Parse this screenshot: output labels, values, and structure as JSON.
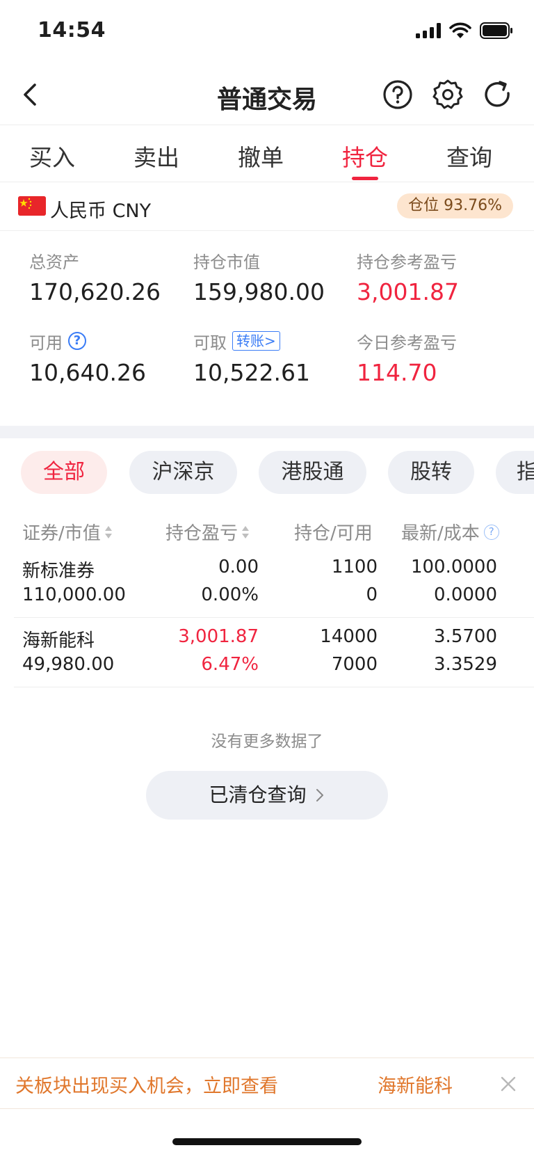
{
  "status": {
    "time": "14:54"
  },
  "nav": {
    "title": "普通交易"
  },
  "tabs": [
    "买入",
    "卖出",
    "撤单",
    "持仓",
    "查询"
  ],
  "active_tab": "持仓",
  "currency": {
    "label": "人民币 CNY",
    "position": "仓位 93.76%"
  },
  "summary": {
    "total_assets_label": "总资产",
    "total_assets": "170,620.26",
    "market_value_label": "持仓市值",
    "market_value": "159,980.00",
    "ref_pnl_label": "持仓参考盈亏",
    "ref_pnl": "3,001.87",
    "available_label": "可用",
    "available": "10,640.26",
    "withdrawable_label": "可取",
    "transfer_label": "转账>",
    "withdrawable": "10,522.61",
    "today_pnl_label": "今日参考盈亏",
    "today_pnl": "114.70"
  },
  "filters": [
    "全部",
    "沪深京",
    "港股通",
    "股转",
    "指"
  ],
  "table": {
    "headers": [
      "证券/市值",
      "持仓盈亏",
      "持仓/可用",
      "最新/成本"
    ],
    "rows": [
      {
        "name": "新标准券",
        "value": "110,000.00",
        "pnl": "0.00",
        "pnl_pct": "0.00%",
        "hold": "1100",
        "avail": "0",
        "latest": "100.0000",
        "cost": "0.0000"
      },
      {
        "name": "海新能科",
        "value": "49,980.00",
        "pnl": "3,001.87",
        "pnl_pct": "6.47%",
        "hold": "14000",
        "avail": "7000",
        "latest": "3.5700",
        "cost": "3.3529"
      }
    ]
  },
  "no_more": "没有更多数据了",
  "cleared_query": "已清仓查询",
  "banner": {
    "message": "关板块出现买入机会，立即查看",
    "stock": "海新能科"
  },
  "colors": {
    "accent_red": "#f0243f",
    "link_blue": "#3a7cf6",
    "banner_orange": "#e0772c"
  }
}
